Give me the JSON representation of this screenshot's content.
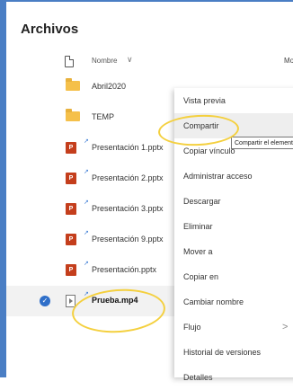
{
  "page": {
    "title": "Archivos"
  },
  "header": {
    "name_label": "Nombre",
    "chevron": "∨",
    "modified_label": "Mod"
  },
  "files": [
    {
      "name": "Abril2020",
      "type": "folder",
      "icon": "folder-icon"
    },
    {
      "name": "TEMP",
      "type": "folder",
      "icon": "folder-icon"
    },
    {
      "name": "Presentación 1.pptx",
      "type": "pptx",
      "icon": "powerpoint-icon",
      "badge": "P"
    },
    {
      "name": "Presentación 2.pptx",
      "type": "pptx",
      "icon": "powerpoint-icon",
      "badge": "P"
    },
    {
      "name": "Presentación 3.pptx",
      "type": "pptx",
      "icon": "powerpoint-icon",
      "badge": "P"
    },
    {
      "name": "Presentación 9.pptx",
      "type": "pptx",
      "icon": "powerpoint-icon",
      "badge": "P"
    },
    {
      "name": "Presentación.pptx",
      "type": "pptx",
      "icon": "powerpoint-icon",
      "badge": "P"
    },
    {
      "name": "Prueba.mp4",
      "type": "video",
      "icon": "video-file-icon",
      "selected": true
    }
  ],
  "sync_glyph": "↗",
  "check_glyph": "✓",
  "context_menu": {
    "items": [
      {
        "label": "Vista previa"
      },
      {
        "label": "Compartir",
        "highlighted": true
      },
      {
        "label": "Copiar vínculo"
      },
      {
        "label": "Administrar acceso"
      },
      {
        "label": "Descargar"
      },
      {
        "label": "Eliminar"
      },
      {
        "label": "Mover a"
      },
      {
        "label": "Copiar en"
      },
      {
        "label": "Cambiar nombre"
      },
      {
        "label": "Flujo",
        "submenu": true
      },
      {
        "label": "Historial de versiones"
      },
      {
        "label": "Detalles"
      }
    ],
    "submenu_chevron": ">"
  },
  "tooltip": {
    "text": "Compartir el elemento"
  },
  "colors": {
    "accent": "#2f6fc9",
    "frame": "#4a7ec4",
    "annotation": "#f4d03f",
    "folder": "#f5c04a",
    "powerpoint": "#c43e1c"
  }
}
